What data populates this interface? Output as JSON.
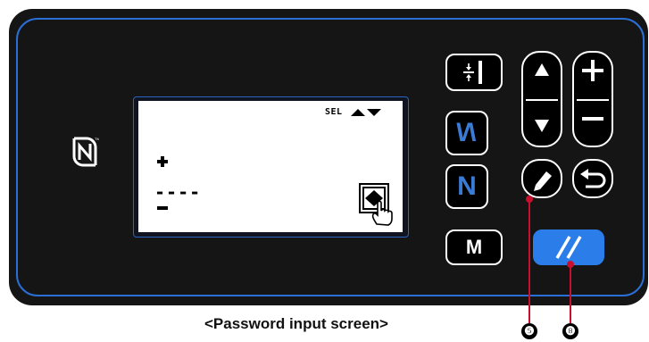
{
  "screen": {
    "sel_label": "SEL",
    "password_placeholder": "----",
    "plus_indicator": "plus-icon",
    "minus_indicator": "minus-icon",
    "key_button_icon": "key-press-icon"
  },
  "panel": {
    "nfc_icon": "nfc-icon",
    "buttons": {
      "thread_trim": "thread-trim-icon",
      "reverse_n": "reverse-n-icon",
      "n_button": "N",
      "m_button": "M",
      "up_arrow": "triangle-up-icon",
      "down_arrow": "triangle-down-icon",
      "plus": "plus-icon",
      "minus": "minus-icon",
      "edit": "pencil-icon",
      "return": "return-icon",
      "ready": "ready-slash-icon"
    }
  },
  "caption": "<Password input screen>",
  "callouts": [
    "❺",
    "❽"
  ],
  "colors": {
    "panel_bg": "#151515",
    "frame_border": "#2a6fd6",
    "ready_button": "#2b7de9",
    "callout_line": "#c8102e"
  }
}
